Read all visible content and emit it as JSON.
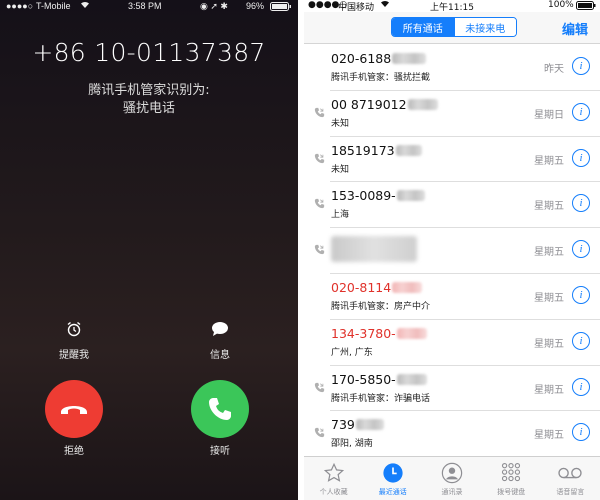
{
  "incoming": {
    "status_bar": {
      "carrier": "T-Mobile",
      "time": "3:58 PM",
      "battery": "96%"
    },
    "number": "+86 10-01137387",
    "identified_by": "腾讯手机管家识别为:",
    "label": "骚扰电话",
    "remind_label": "提醒我",
    "message_label": "信息",
    "decline_label": "拒绝",
    "accept_label": "接听",
    "colors": {
      "decline": "#ee3c33",
      "accept": "#3bc659"
    }
  },
  "recents": {
    "status_bar": {
      "carrier": "中国移动",
      "time": "上午11:15",
      "battery": "100%"
    },
    "segment_all": "所有通话",
    "segment_missed": "未接来电",
    "edit_label": "编辑",
    "accent": "#157efb",
    "calls": [
      {
        "number": "020-6188",
        "sub": "腾讯手机管家：骚扰拦截",
        "when": "昨天",
        "missed": false,
        "phone_icon": false,
        "blur_width": 34
      },
      {
        "number": "00 8719012",
        "sub": "未知",
        "when": "星期日",
        "missed": false,
        "phone_icon": true,
        "blur_width": 30
      },
      {
        "number": "18519173",
        "sub": "未知",
        "when": "星期五",
        "missed": false,
        "phone_icon": true,
        "blur_width": 26
      },
      {
        "number": "153-0089-",
        "sub": "上海",
        "when": "星期五",
        "missed": false,
        "phone_icon": true,
        "blur_width": 28
      },
      {
        "number": "",
        "sub": "",
        "when": "星期五",
        "missed": false,
        "phone_icon": true,
        "blur_width": 0
      },
      {
        "number": "020-8114",
        "sub": "腾讯手机管家：房产中介",
        "when": "星期五",
        "missed": true,
        "phone_icon": false,
        "blur_width": 30
      },
      {
        "number": "134-3780-",
        "sub": "广州, 广东",
        "when": "星期五",
        "missed": true,
        "phone_icon": false,
        "blur_width": 30
      },
      {
        "number": "170-5850-",
        "sub": "腾讯手机管家：诈骗电话",
        "when": "星期五",
        "missed": false,
        "phone_icon": true,
        "blur_width": 30
      },
      {
        "number": "739",
        "sub": "邵阳, 湖南",
        "when": "星期五",
        "missed": false,
        "phone_icon": true,
        "blur_width": 28
      }
    ],
    "tabs": [
      {
        "label": "个人收藏",
        "icon": "star-icon",
        "active": false
      },
      {
        "label": "最近通话",
        "icon": "clock-icon",
        "active": true
      },
      {
        "label": "通讯录",
        "icon": "contacts-icon",
        "active": false
      },
      {
        "label": "拨号键盘",
        "icon": "keypad-icon",
        "active": false
      },
      {
        "label": "语音留言",
        "icon": "voicemail-icon",
        "active": false
      }
    ]
  }
}
